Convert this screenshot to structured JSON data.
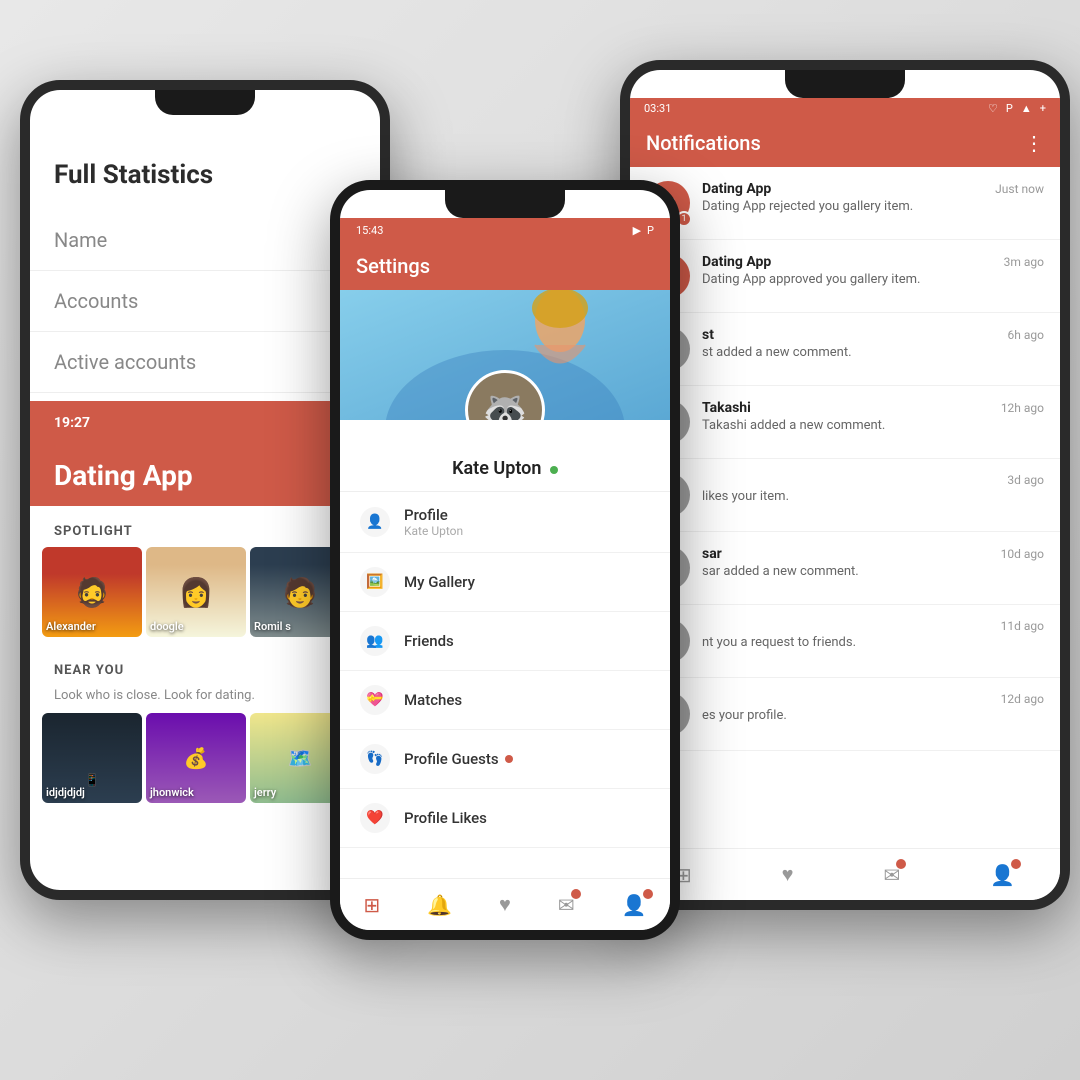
{
  "phones": {
    "left": {
      "title": "Full Statistics",
      "stats_items": [
        "Name",
        "Accounts",
        "Active accounts"
      ],
      "active_time": "19:27",
      "app_name": "Dating App",
      "spotlight_label": "SPOTLIGHT",
      "spotlight_users": [
        {
          "name": "Alexander",
          "bg": "face-alex"
        },
        {
          "name": "doogle",
          "bg": "face-google"
        },
        {
          "name": "Romil s",
          "bg": "face-romil"
        }
      ],
      "near_you_label": "NEAR YOU",
      "near_you_desc": "Look who is close. Look for dating.",
      "near_users": [
        {
          "name": "idjdjdjdj",
          "bg": "near-dark1"
        },
        {
          "name": "jhonwick",
          "bg": "near-dark2"
        },
        {
          "name": "jerry",
          "bg": "near-map"
        }
      ]
    },
    "middle": {
      "header": "Settings",
      "status_time": "15:43",
      "profile_name": "Kate Upton",
      "online": true,
      "menu_items": [
        {
          "icon": "👤",
          "label": "Profile",
          "sub": "Kate Upton"
        },
        {
          "icon": "🖼️",
          "label": "My Gallery",
          "sub": ""
        },
        {
          "icon": "👥",
          "label": "Friends",
          "sub": ""
        },
        {
          "icon": "💝",
          "label": "Matches",
          "sub": ""
        },
        {
          "icon": "👣",
          "label": "Profile Guests",
          "sub": "",
          "dot": true
        },
        {
          "icon": "❤️",
          "label": "Profile Likes",
          "sub": ""
        }
      ],
      "nav_items": [
        "⊞",
        "🔔",
        "♥",
        "✉",
        "👤"
      ]
    },
    "right": {
      "header": "Notifications",
      "status_time": "03:31",
      "notifications": [
        {
          "app": "Dating App",
          "time": "Just now",
          "desc": "Dating App rejected you gallery item.",
          "badge": "1"
        },
        {
          "app": "Dating App",
          "time": "3m ago",
          "desc": "Dating App approved you gallery item.",
          "badge": ""
        },
        {
          "app": "st",
          "time": "6h ago",
          "desc": "st added a new comment.",
          "badge": ""
        },
        {
          "app": "Takashi",
          "time": "12h ago",
          "desc": "Takashi added a new comment.",
          "badge": ""
        },
        {
          "app": "",
          "time": "3d ago",
          "desc": "likes your item.",
          "badge": ""
        },
        {
          "app": "sar",
          "time": "10d ago",
          "desc": "sar added a new comment.",
          "badge": ""
        },
        {
          "app": "",
          "time": "11d ago",
          "desc": "nt you a request to friends.",
          "badge": ""
        },
        {
          "app": "",
          "time": "12d ago",
          "desc": "es your profile.",
          "badge": ""
        }
      ]
    }
  }
}
